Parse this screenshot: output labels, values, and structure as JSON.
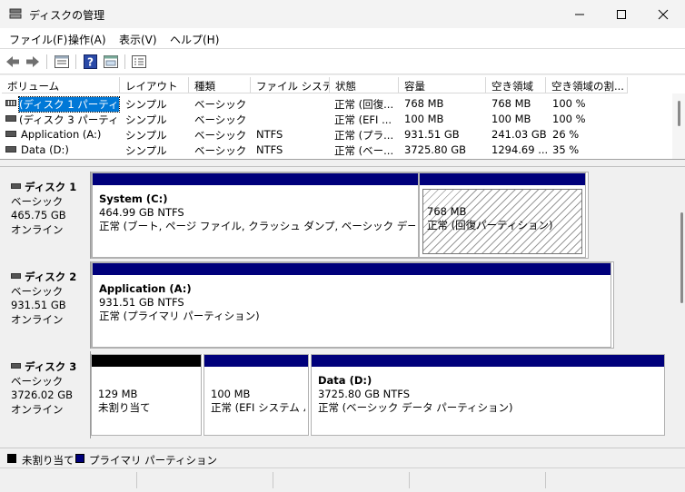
{
  "window": {
    "title": "ディスクの管理",
    "buttons": {
      "minimize": "—",
      "maximize": "☐",
      "close": "✕"
    }
  },
  "menu": [
    {
      "label": "ファイル(F)"
    },
    {
      "label": "操作(A)"
    },
    {
      "label": "表示(V)"
    },
    {
      "label": "ヘルプ(H)"
    }
  ],
  "toolbar": {
    "icons": [
      "back-arrow-icon",
      "forward-arrow-icon",
      "properties-icon",
      "help-icon",
      "console-icon",
      "disk-list-icon"
    ]
  },
  "volumes": {
    "columns": [
      "ボリューム",
      "レイアウト",
      "種類",
      "ファイル システム",
      "状態",
      "容量",
      "空き領域",
      "空き領域の割..."
    ],
    "rows": [
      {
        "volume": "(ディスク 1 パーティシ...",
        "layout": "シンプル",
        "type": "ベーシック",
        "fs": "",
        "status": "正常 (回復...",
        "capacity": "768 MB",
        "free": "768 MB",
        "percent": "100 %"
      },
      {
        "volume": "(ディスク 3 パーティシ...",
        "layout": "シンプル",
        "type": "ベーシック",
        "fs": "",
        "status": "正常 (EFI ...",
        "capacity": "100 MB",
        "free": "100 MB",
        "percent": "100 %"
      },
      {
        "volume": "Application (A:)",
        "layout": "シンプル",
        "type": "ベーシック",
        "fs": "NTFS",
        "status": "正常 (プラ...",
        "capacity": "931.51 GB",
        "free": "241.03 GB",
        "percent": "26 %"
      },
      {
        "volume": "Data (D:)",
        "layout": "シンプル",
        "type": "ベーシック",
        "fs": "NTFS",
        "status": "正常 (ベー...",
        "capacity": "3725.80 GB",
        "free": "1294.69 ...",
        "percent": "35 %"
      }
    ]
  },
  "disks": [
    {
      "name": "ディスク 1",
      "type": "ベーシック",
      "size": "465.75 GB",
      "state": "オンライン",
      "partitions": [
        {
          "name": "System  (C:)",
          "size": "464.99 GB NTFS",
          "status": "正常 (ブート, ページ ファイル, クラッシュ ダンプ, ベーシック データ パーティション)"
        },
        {
          "name": "",
          "size": "768 MB",
          "status": "正常 (回復パーティション)"
        }
      ]
    },
    {
      "name": "ディスク 2",
      "type": "ベーシック",
      "size": "931.51 GB",
      "state": "オンライン",
      "partitions": [
        {
          "name": "Application  (A:)",
          "size": "931.51 GB NTFS",
          "status": "正常 (プライマリ パーティション)"
        }
      ]
    },
    {
      "name": "ディスク 3",
      "type": "ベーシック",
      "size": "3726.02 GB",
      "state": "オンライン",
      "partitions": [
        {
          "name": "",
          "size": "129 MB",
          "status": "未割り当て"
        },
        {
          "name": "",
          "size": "100 MB",
          "status": "正常 (EFI システム パ"
        },
        {
          "name": "Data  (D:)",
          "size": "3725.80 GB NTFS",
          "status": "正常 (ベーシック データ パーティション)"
        }
      ]
    }
  ],
  "legend": [
    {
      "label": "未割り当て",
      "color": "#000000"
    },
    {
      "label": "プライマリ パーティション",
      "color": "#00007b"
    }
  ],
  "colors": {
    "primary_partition": "#00007b",
    "unallocated": "#000000",
    "selection": "#0078d7"
  }
}
